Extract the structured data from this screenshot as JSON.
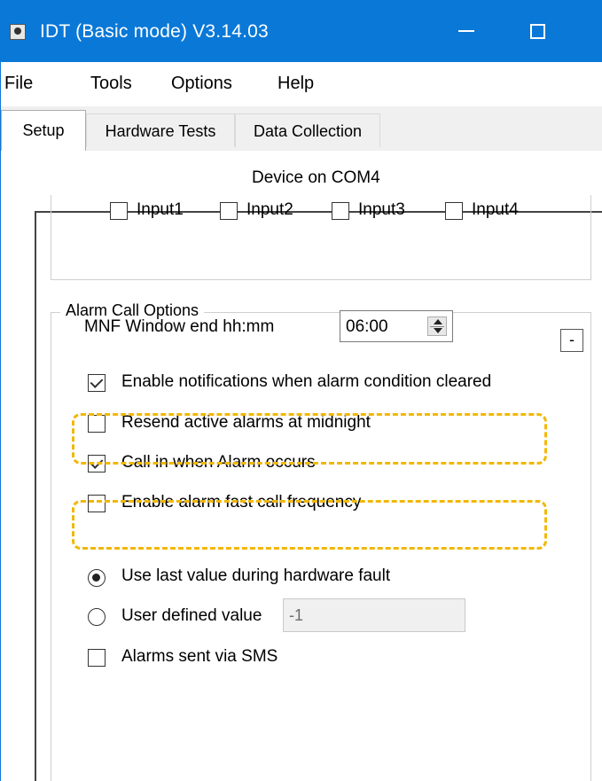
{
  "window": {
    "title": "IDT (Basic mode) V3.14.03",
    "colors": {
      "titlebar": "#0a78d7",
      "highlight": "#f2b705"
    }
  },
  "menu": [
    "File",
    "Tools",
    "Options",
    "Help"
  ],
  "tabs": [
    {
      "label": "Setup",
      "active": true
    },
    {
      "label": "Hardware Tests",
      "active": false
    },
    {
      "label": "Data Collection",
      "active": false
    }
  ],
  "device_label": "Device on COM4",
  "inputs_group": {
    "items": [
      {
        "label": "Input1",
        "checked": false
      },
      {
        "label": "Input2",
        "checked": false
      },
      {
        "label": "Input3",
        "checked": false
      },
      {
        "label": "Input4",
        "checked": false
      }
    ]
  },
  "alarm_group": {
    "title": "Alarm Call Options",
    "collapse_label": "-",
    "mnf_label": "MNF Window end hh:mm",
    "mnf_value": "06:00",
    "options": [
      {
        "label": "Enable notifications when alarm condition cleared",
        "checked": true,
        "highlighted": true
      },
      {
        "label": "Resend active alarms at midnight",
        "checked": false,
        "highlighted": false
      },
      {
        "label": "Call in when Alarm occurs",
        "checked": true,
        "highlighted": true
      },
      {
        "label": "Enable alarm fast call frequency",
        "checked": false,
        "highlighted": false
      }
    ],
    "radio_last": {
      "label": "Use last value during hardware fault",
      "selected": true
    },
    "radio_user": {
      "label": "User defined value",
      "selected": false
    },
    "user_value": "-1",
    "sms": {
      "label": "Alarms sent via SMS",
      "checked": false
    }
  }
}
